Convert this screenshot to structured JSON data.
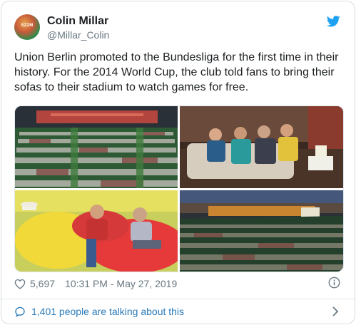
{
  "tweet": {
    "avatar_text": "SZ2M",
    "display_name": "Colin Millar",
    "handle": "@Millar_Colin",
    "text": "Union Berlin promoted to the Bundesliga for the first time in their history. For the 2014 World Cup, the club told fans to bring their sofas to their stadium to watch games for free.",
    "like_count": "5,697",
    "timestamp": "10:31 PM - May 27, 2019",
    "conversation_text": "1,401 people are talking about this"
  },
  "icons": {
    "brand": "twitter-bird-icon",
    "like": "heart-icon",
    "info": "info-icon",
    "conversation": "speech-bubble-icon",
    "more": "chevron-right-icon"
  },
  "colors": {
    "brand": "#1da1f2",
    "link": "#2b7bb9",
    "muted": "#697882",
    "text": "#1c2022"
  }
}
